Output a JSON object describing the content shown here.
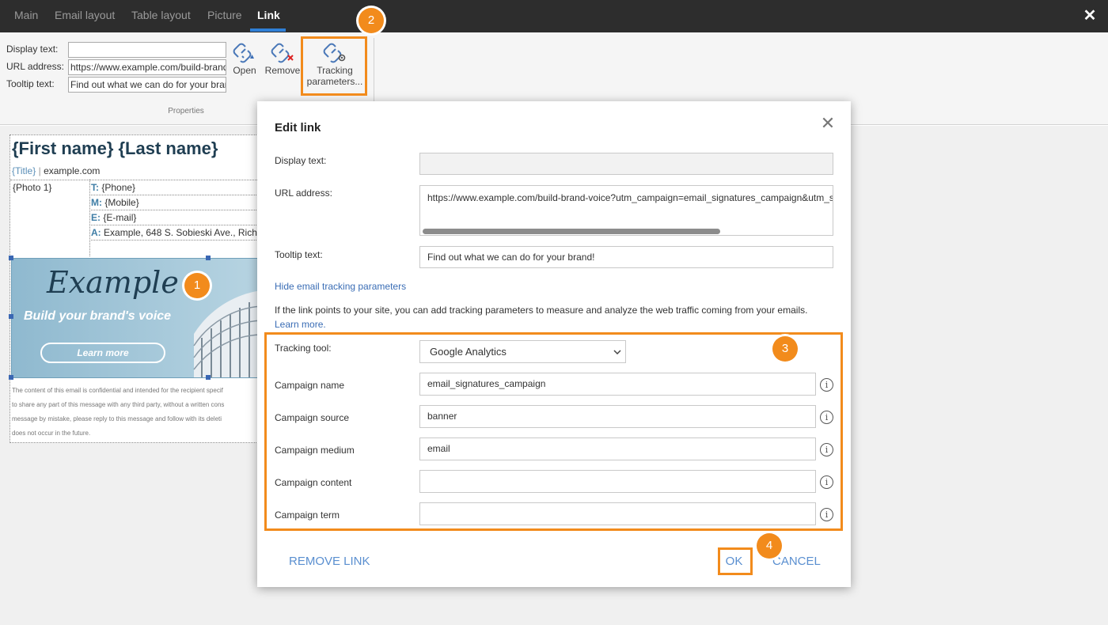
{
  "topbar": {
    "tabs": [
      "Main",
      "Email layout",
      "Table layout",
      "Picture",
      "Link"
    ],
    "active_tab": "Link"
  },
  "ribbon": {
    "display_text_label": "Display text:",
    "display_text_value": "",
    "url_label": "URL address:",
    "url_value": "https://www.example.com/build-brand-voice",
    "tooltip_label": "Tooltip text:",
    "tooltip_value": "Find out what we can do for your brand!",
    "open_label": "Open",
    "remove_label": "Remove",
    "tracking_label_line1": "Tracking",
    "tracking_label_line2": "parameters...",
    "group_label": "Properties"
  },
  "signature": {
    "name": "{First name} {Last name}",
    "title": "{Title}",
    "separator": "|",
    "website": "example.com",
    "photo": "{Photo 1}",
    "phone_key": "T:",
    "phone_value": "{Phone}",
    "mobile_key": "M:",
    "mobile_value": "{Mobile}",
    "email_key": "E:",
    "email_value": "{E-mail}",
    "address_key": "A:",
    "address_value": "Example, 648 S. Sobieski Ave., Rich",
    "banner_logo": "Example",
    "banner_tagline": "Build your brand's voice",
    "banner_button": "Learn more",
    "disclaimer": [
      "The content of this email is confidential and intended for the recipient specif",
      "to share any part of this message with any third party, without a written cons",
      "message by mistake, please reply to this message and follow with its deleti",
      "does not occur in the future."
    ]
  },
  "dialog": {
    "title": "Edit link",
    "display_text_label": "Display text:",
    "display_text_value": "",
    "url_label": "URL address:",
    "url_value": "https://www.example.com/build-brand-voice?utm_campaign=email_signatures_campaign&utm_s",
    "tooltip_label": "Tooltip text:",
    "tooltip_value": "Find out what we can do for your brand!",
    "hide_tracking_link": "Hide email tracking parameters",
    "info_text": "If the link points to your site, you can add tracking parameters to measure and analyze the web traffic coming from your emails.",
    "learn_more": "Learn more.",
    "tracking_tool_label": "Tracking tool:",
    "tracking_tool_value": "Google Analytics",
    "fields": [
      {
        "label": "Campaign name",
        "value": "email_signatures_campaign"
      },
      {
        "label": "Campaign source",
        "value": "banner"
      },
      {
        "label": "Campaign medium",
        "value": "email"
      },
      {
        "label": "Campaign content",
        "value": ""
      },
      {
        "label": "Campaign term",
        "value": ""
      }
    ],
    "remove_link": "REMOVE LINK",
    "ok": "OK",
    "cancel": "CANCEL"
  },
  "badges": [
    "1",
    "2",
    "3",
    "4"
  ],
  "colors": {
    "accent": "#f28b1c",
    "topbar": "#2d2d2d",
    "link": "#3a6db5",
    "active_tab_underline": "#2f7fd6"
  }
}
